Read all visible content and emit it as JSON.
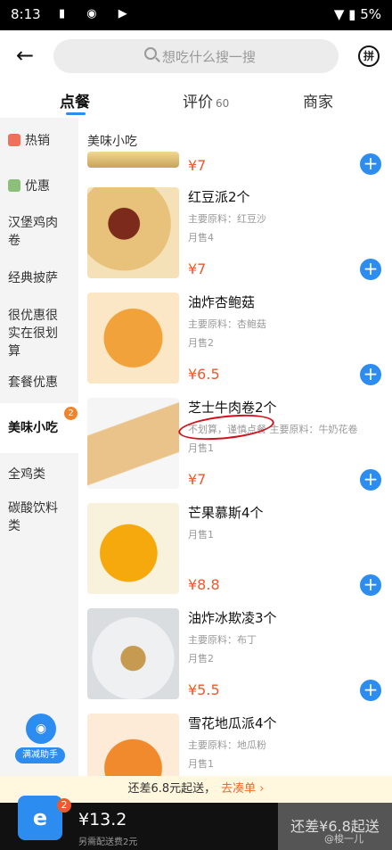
{
  "status_bar": {
    "time": "8:13",
    "battery": "5%"
  },
  "header": {
    "search_placeholder": "想吃什么搜一搜",
    "brand_logo": "拼"
  },
  "tabs": [
    {
      "label": "点餐",
      "count": ""
    },
    {
      "label": "评价",
      "count": "60"
    },
    {
      "label": "商家",
      "count": ""
    }
  ],
  "sidebar": {
    "categories": [
      {
        "label": "热销"
      },
      {
        "label": "优惠"
      },
      {
        "label": "汉堡鸡肉卷"
      },
      {
        "label": "经典披萨"
      },
      {
        "label": "很优惠很实在很划算"
      },
      {
        "label": "套餐优惠"
      },
      {
        "label": "美味小吃"
      },
      {
        "label": "全鸡类"
      },
      {
        "label": "碳酸饮料类"
      }
    ],
    "active_badge": "2",
    "helper_label": "满减助手"
  },
  "main": {
    "section_title": "美味小吃",
    "items": [
      {
        "name": "",
        "material": "",
        "sold": "",
        "price": "¥7"
      },
      {
        "name": "红豆派2个",
        "material": "主要原料：红豆沙",
        "sold": "月售4",
        "price": "¥7"
      },
      {
        "name": "油炸杏鲍菇",
        "material": "主要原料：杏鲍菇",
        "sold": "月售2",
        "price": "¥6.5"
      },
      {
        "name": "芝士牛肉卷2个",
        "material": "不划算，谨慎点餐  主要原料：牛奶花卷",
        "sold": "月售1",
        "price": "¥7"
      },
      {
        "name": "芒果慕斯4个",
        "material": "",
        "sold": "月售1",
        "price": "¥8.8"
      },
      {
        "name": "油炸冰欺凌3个",
        "material": "主要原料：布丁",
        "sold": "月售2",
        "price": "¥5.5"
      },
      {
        "name": "雪花地瓜派4个",
        "material": "主要原料：地瓜粉",
        "sold": "月售1",
        "price": ""
      }
    ]
  },
  "promo": {
    "text": "还差6.8元起送，",
    "link": "去凑单 ›"
  },
  "cart": {
    "badge": "2",
    "total": "¥13.2",
    "fee": "另需配送费2元",
    "checkout": "还差¥6.8起送"
  },
  "watermark": "@梭一儿",
  "colors": {
    "accent": "#2c8cf0",
    "price": "#ec5a2c",
    "sidebar_bg": "#f4f4f4"
  }
}
